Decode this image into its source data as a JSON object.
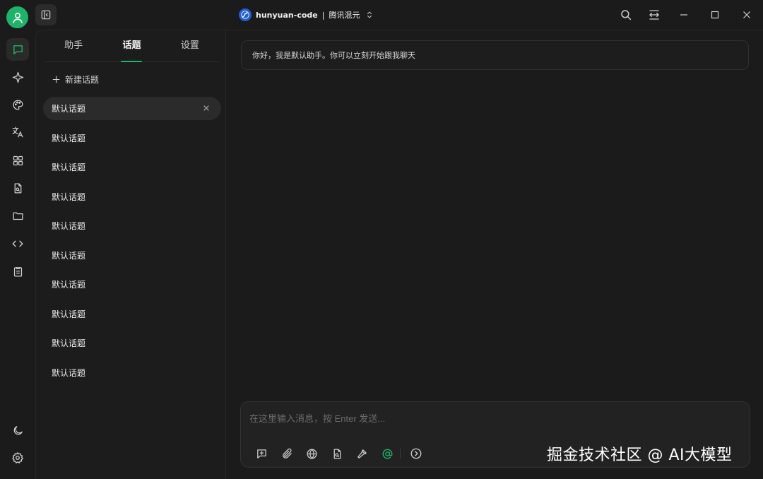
{
  "titlebar": {
    "model_name": "hunyuan-code",
    "separator": "|",
    "provider": "腾讯混元",
    "search_label": "search",
    "minimize_label": "minimize",
    "maximize_label": "maximize",
    "close_label": "close"
  },
  "rail": {
    "items": [
      "chat-icon",
      "sparkle-icon",
      "palette-icon",
      "translate-icon",
      "apps-icon",
      "file-icon",
      "folder-icon",
      "code-icon",
      "notes-icon"
    ],
    "bottom": [
      "moon-icon",
      "gear-icon"
    ]
  },
  "sidebar": {
    "tabs": [
      {
        "label": "助手",
        "active": false
      },
      {
        "label": "话题",
        "active": true
      },
      {
        "label": "设置",
        "active": false
      }
    ],
    "new_topic_label": "新建话题",
    "topics": [
      {
        "label": "默认话题"
      },
      {
        "label": "默认话题"
      },
      {
        "label": "默认话题"
      },
      {
        "label": "默认话题"
      },
      {
        "label": "默认话题"
      },
      {
        "label": "默认话题"
      },
      {
        "label": "默认话题"
      },
      {
        "label": "默认话题"
      },
      {
        "label": "默认话题"
      },
      {
        "label": "默认话题"
      }
    ]
  },
  "main": {
    "greeting": "你好，我是默认助手。你可以立刻开始跟我聊天",
    "composer": {
      "placeholder": "在这里输入消息，按 Enter 发送...",
      "value": ""
    }
  },
  "watermark": "掘金技术社区 @ AI大模型",
  "colors": {
    "accent": "#1fb36a",
    "background": "#1b1b1b",
    "panel": "#2b2b2b"
  }
}
